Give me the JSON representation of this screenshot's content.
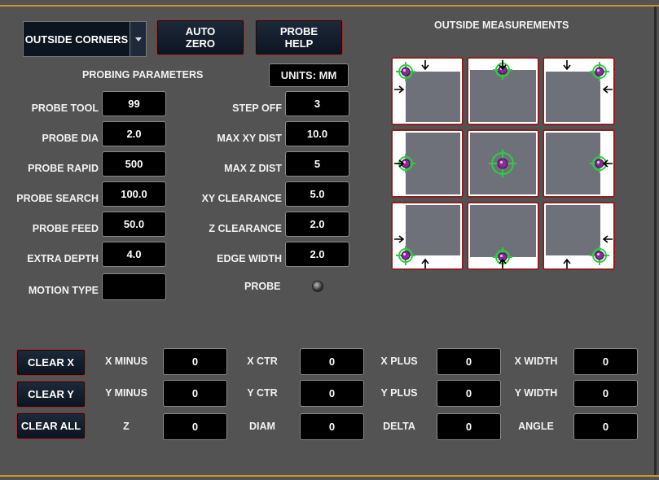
{
  "toolbar": {
    "mode_selected": "OUTSIDE CORNERS",
    "auto_zero_label": "AUTO\nZERO",
    "probe_help_label": "PROBE\nHELP"
  },
  "params": {
    "title": "PROBING PARAMETERS",
    "units": "UNITS: MM",
    "left": [
      {
        "label": "PROBE TOOL",
        "value": "99"
      },
      {
        "label": "PROBE DIA",
        "value": "2.0"
      },
      {
        "label": "PROBE RAPID",
        "value": "500"
      },
      {
        "label": "PROBE SEARCH",
        "value": "100.0"
      },
      {
        "label": "PROBE FEED",
        "value": "50.0"
      },
      {
        "label": "EXTRA DEPTH",
        "value": "4.0"
      },
      {
        "label": "MOTION TYPE",
        "value": ""
      }
    ],
    "right": [
      {
        "label": "STEP OFF",
        "value": "3"
      },
      {
        "label": "MAX XY DIST",
        "value": "10.0"
      },
      {
        "label": "MAX Z DIST",
        "value": "5"
      },
      {
        "label": "XY CLEARANCE",
        "value": "5.0"
      },
      {
        "label": "Z CLEARANCE",
        "value": "2.0"
      },
      {
        "label": "EDGE WIDTH",
        "value": "2.0"
      }
    ],
    "probe_label": "PROBE"
  },
  "measurements": {
    "title": "OUTSIDE MEASUREMENTS"
  },
  "results": {
    "buttons": [
      "CLEAR X",
      "CLEAR Y",
      "CLEAR ALL"
    ],
    "rows": [
      [
        {
          "label": "X MINUS",
          "value": "0"
        },
        {
          "label": "X CTR",
          "value": "0"
        },
        {
          "label": "X PLUS",
          "value": "0"
        },
        {
          "label": "X WIDTH",
          "value": "0"
        }
      ],
      [
        {
          "label": "Y MINUS",
          "value": "0"
        },
        {
          "label": "Y CTR",
          "value": "0"
        },
        {
          "label": "Y PLUS",
          "value": "0"
        },
        {
          "label": "Y WIDTH",
          "value": "0"
        }
      ],
      [
        {
          "label": "Z",
          "value": "0"
        },
        {
          "label": "DIAM",
          "value": "0"
        },
        {
          "label": "DELTA",
          "value": "0"
        },
        {
          "label": "ANGLE",
          "value": "0"
        }
      ]
    ]
  },
  "colors": {
    "accent_border": "#9b2c2c",
    "frame_gold": "#c8962e",
    "probe_green": "#2ecc40",
    "probe_ball": "#8a2a9a"
  }
}
